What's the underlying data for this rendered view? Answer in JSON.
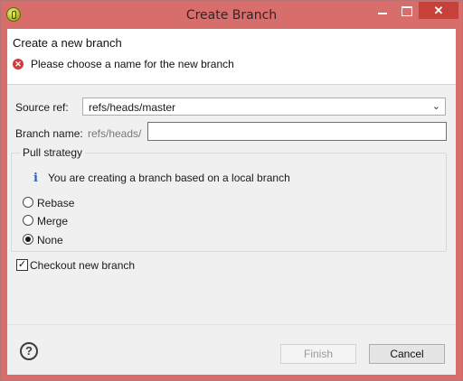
{
  "window": {
    "title": "Create Branch"
  },
  "header": {
    "title": "Create a new branch",
    "message": "Please choose a name for the new branch"
  },
  "form": {
    "source_ref_label": "Source ref:",
    "source_ref_value": "refs/heads/master",
    "branch_name_label": "Branch name:",
    "branch_name_prefix": "refs/heads/",
    "branch_name_value": ""
  },
  "pull_strategy": {
    "title": "Pull strategy",
    "info": "You are creating a branch based on a local branch",
    "options": [
      {
        "label": "Rebase",
        "checked": false
      },
      {
        "label": "Merge",
        "checked": false
      },
      {
        "label": "None",
        "checked": true
      }
    ]
  },
  "checkout": {
    "label": "Checkout new branch",
    "checked": true
  },
  "buttons": {
    "finish": "Finish",
    "cancel": "Cancel"
  },
  "icons": {
    "app": "eclipse-app-icon",
    "error": "error-icon",
    "info": "info-icon",
    "help": "help-icon",
    "dropdown": "chevron-down-icon"
  },
  "colors": {
    "titlebar": "#d86e6c",
    "close_button": "#c7413b",
    "focus_border": "#3c7fb1"
  }
}
